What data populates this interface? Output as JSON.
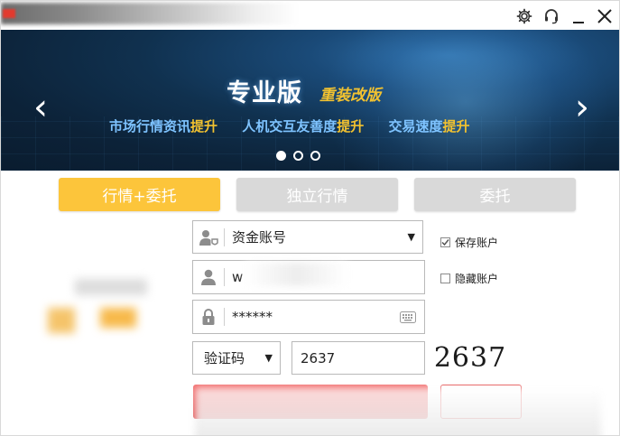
{
  "window": {
    "settings_icon": "gear-icon",
    "headset_icon": "headset-icon",
    "minimize_icon": "minimize-icon",
    "close_icon": "close-icon"
  },
  "banner": {
    "title": "专业版",
    "subtitle": "重装改版",
    "features": [
      {
        "text": "市场行情资讯",
        "highlight": "提升"
      },
      {
        "text": "人机交互友善度",
        "highlight": "提升"
      },
      {
        "text": "交易速度",
        "highlight": "提升"
      }
    ],
    "prev_arrow": "‹",
    "next_arrow": "›",
    "slides": 3,
    "active_slide": 1,
    "colors": {
      "title": "#ffffff",
      "subtitle": "#f2c230",
      "feature_text": "#7ec3ff",
      "highlight": "#f2c230"
    }
  },
  "tabs": [
    {
      "label": "行情+委托",
      "active": true
    },
    {
      "label": "独立行情",
      "active": false
    },
    {
      "label": "委托",
      "active": false
    }
  ],
  "form": {
    "account_type": {
      "value": "资金账号",
      "icon": "user-shield-icon"
    },
    "account": {
      "value": "w",
      "icon": "user-icon"
    },
    "password": {
      "value": "******",
      "icon": "lock-icon",
      "keyboard_icon": "keyboard-icon"
    },
    "verify": {
      "type_value": "验证码",
      "code_value": "2637"
    },
    "captcha_image_text": "2637",
    "save_account": {
      "label": "保存账户",
      "checked": true
    },
    "hide_account": {
      "label": "隐藏账户",
      "checked": false
    }
  },
  "colors": {
    "tab_active": "#fcc53b",
    "tab_inactive": "#d9d9d9",
    "login_button": "#e24848"
  }
}
